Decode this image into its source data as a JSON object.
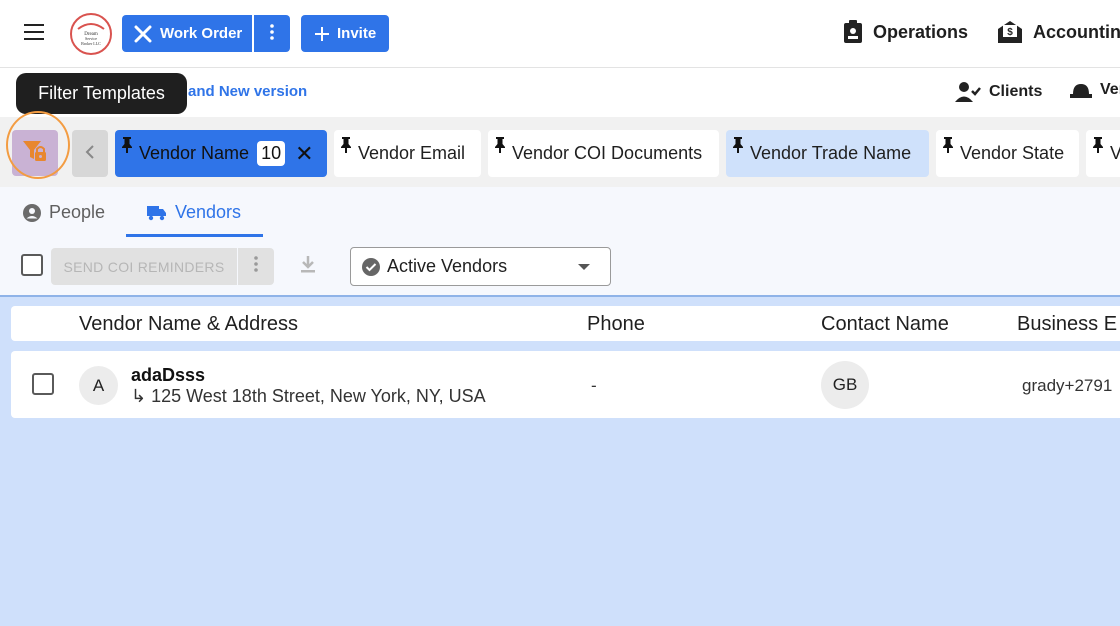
{
  "header": {
    "work_order_label": "Work Order",
    "invite_label": "Invite",
    "operations_label": "Operations",
    "accounting_label": "Accountin",
    "logo_text": "Dream Service Broker LLC"
  },
  "subbar": {
    "tooltip": "Filter Templates",
    "new_version_link": "and New version",
    "clients_label": "Clients",
    "vendors_label": "Ver"
  },
  "filter_chips": [
    {
      "label": "Vendor Name",
      "count": "10",
      "state": "active"
    },
    {
      "label": "Vendor Email",
      "state": "normal"
    },
    {
      "label": "Vendor COI Documents",
      "state": "normal"
    },
    {
      "label": "Vendor Trade Name",
      "state": "highlighted"
    },
    {
      "label": "Vendor State",
      "state": "normal"
    },
    {
      "label": "V",
      "state": "normal"
    }
  ],
  "tabs": {
    "people": "People",
    "vendors": "Vendors"
  },
  "toolbar": {
    "send_coi_label": "SEND COI REMINDERS",
    "status_select": "Active Vendors"
  },
  "table": {
    "columns": [
      "Vendor Name & Address",
      "Phone",
      "Contact Name",
      "Business E"
    ],
    "rows": [
      {
        "avatar": "A",
        "name": "adaDsss",
        "address": "↳ 125 West 18th Street, New York, NY, USA",
        "phone": "-",
        "contact_initials": "GB",
        "business_email": "grady+2791"
      }
    ]
  },
  "colors": {
    "primary": "#2f74e8",
    "highlight_chip": "#cfe1fb",
    "table_bg": "#cfe0fb",
    "filter_btn": "#c9b2d4",
    "focus_ring": "#f39c42"
  }
}
